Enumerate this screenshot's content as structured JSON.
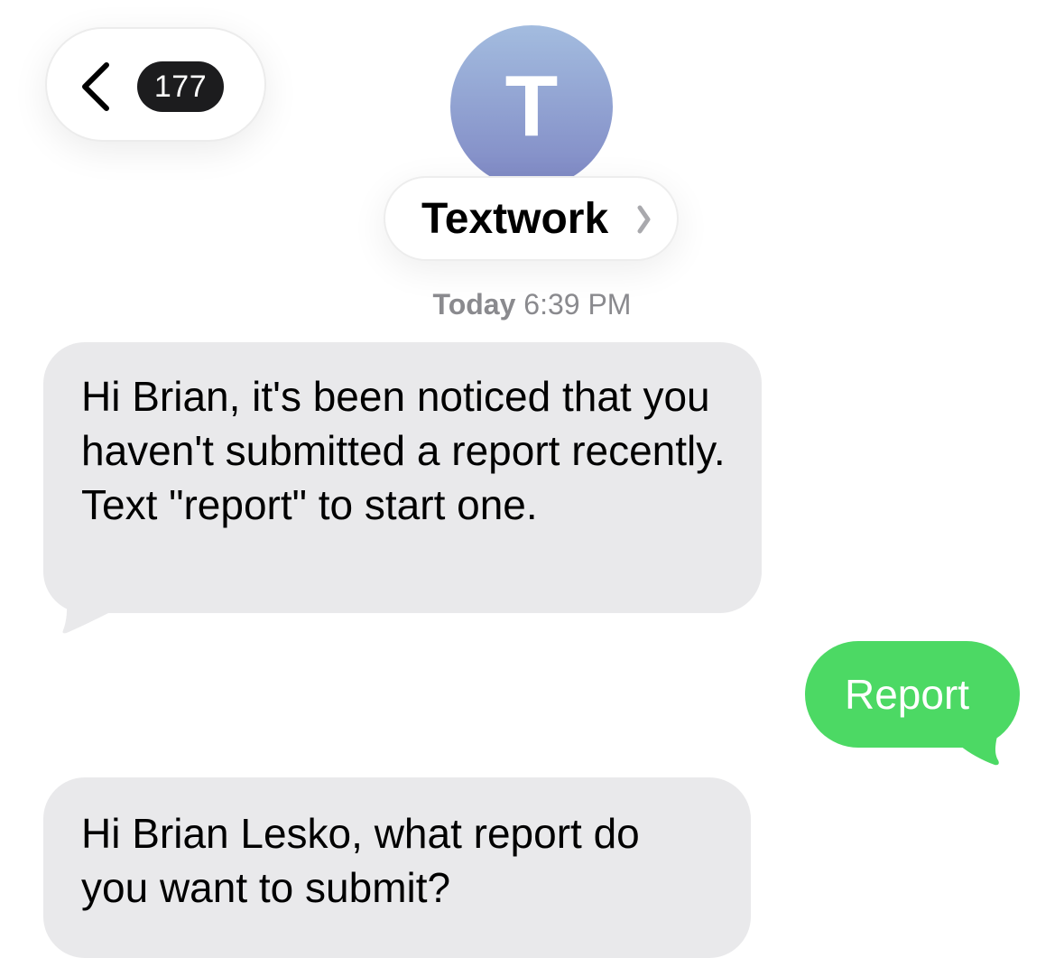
{
  "header": {
    "back_badge_count": "177",
    "avatar_initial": "T",
    "contact_name": "Textwork"
  },
  "timestamp": {
    "day": "Today",
    "time": "6:39 PM"
  },
  "messages": [
    {
      "direction": "incoming",
      "text": "Hi Brian, it's been noticed that you haven't submitted a report recently. Text \"report\" to start one."
    },
    {
      "direction": "outgoing",
      "text": "Report"
    },
    {
      "direction": "incoming",
      "text": "Hi Brian Lesko, what report do you want to submit?"
    }
  ],
  "icons": {
    "back": "chevron-left-icon",
    "name_disclosure": "chevron-right-icon"
  },
  "colors": {
    "incoming_bubble": "#e9e9eb",
    "outgoing_bubble": "#4cd964",
    "badge": "#1c1c1e",
    "avatar_top": "#a3bcdf",
    "avatar_bottom": "#7f88c4",
    "timestamp_text": "#8a8a8e"
  }
}
